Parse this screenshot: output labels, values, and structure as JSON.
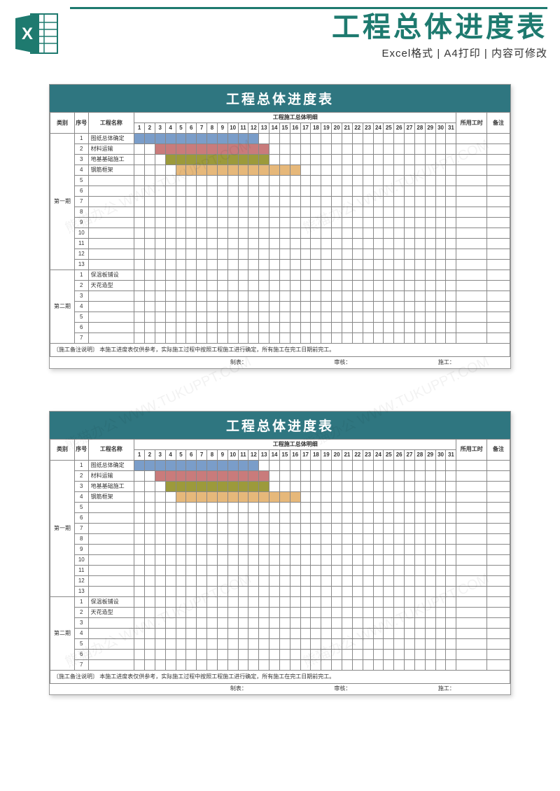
{
  "header": {
    "main_title": "工程总体进度表",
    "sub_title": "Excel格式 | A4打印 | 内容可修改"
  },
  "sheet": {
    "title": "工程总体进度表",
    "cols": {
      "category": "类别",
      "seq": "序号",
      "name": "工程名称",
      "detail_header": "工程施工总体明细",
      "hours": "所用工时",
      "remark": "备注"
    },
    "phases": [
      {
        "label": "第一期",
        "rows": [
          {
            "seq": "1",
            "name": "图纸总体确定",
            "bar": {
              "start": 1,
              "end": 12,
              "cls": "bar-blue"
            }
          },
          {
            "seq": "2",
            "name": "材料运输",
            "bar": {
              "start": 3,
              "end": 13,
              "cls": "bar-red"
            }
          },
          {
            "seq": "3",
            "name": "地基基础施工",
            "bar": {
              "start": 4,
              "end": 13,
              "cls": "bar-olive"
            }
          },
          {
            "seq": "4",
            "name": "钢筋框架",
            "bar": {
              "start": 5,
              "end": 16,
              "cls": "bar-orange"
            }
          },
          {
            "seq": "5",
            "name": ""
          },
          {
            "seq": "6",
            "name": ""
          },
          {
            "seq": "7",
            "name": ""
          },
          {
            "seq": "8",
            "name": ""
          },
          {
            "seq": "9",
            "name": ""
          },
          {
            "seq": "10",
            "name": ""
          },
          {
            "seq": "11",
            "name": ""
          },
          {
            "seq": "12",
            "name": ""
          },
          {
            "seq": "13",
            "name": ""
          }
        ]
      },
      {
        "label": "第二期",
        "rows": [
          {
            "seq": "1",
            "name": "保温板铺设"
          },
          {
            "seq": "2",
            "name": "天花造型"
          },
          {
            "seq": "3",
            "name": ""
          },
          {
            "seq": "4",
            "name": ""
          },
          {
            "seq": "5",
            "name": ""
          },
          {
            "seq": "6",
            "name": ""
          },
          {
            "seq": "7",
            "name": ""
          }
        ]
      }
    ],
    "note_label": "〔施工备注说明〕",
    "note_text": "本施工进度表仅供参考，实际施工过程中按照工程施工进行确定，所有施工在完工日期前完工。",
    "footer": {
      "maker": "制表：",
      "reviewer": "审核：",
      "builder": "施工："
    }
  },
  "chart_data": {
    "type": "bar",
    "title": "工程总体进度表",
    "xlabel": "工程施工总体明细 (日 1–31)",
    "ylabel": "工程名称",
    "categories": [
      "图纸总体确定",
      "材料运输",
      "地基基础施工",
      "钢筋框架"
    ],
    "series": [
      {
        "name": "图纸总体确定",
        "start": 1,
        "end": 12
      },
      {
        "name": "材料运输",
        "start": 3,
        "end": 13
      },
      {
        "name": "地基基础施工",
        "start": 4,
        "end": 13
      },
      {
        "name": "钢筋框架",
        "start": 5,
        "end": 16
      }
    ],
    "xlim": [
      1,
      31
    ]
  },
  "watermark": "熊猫办公 WWW.TUKUPPT.COM"
}
